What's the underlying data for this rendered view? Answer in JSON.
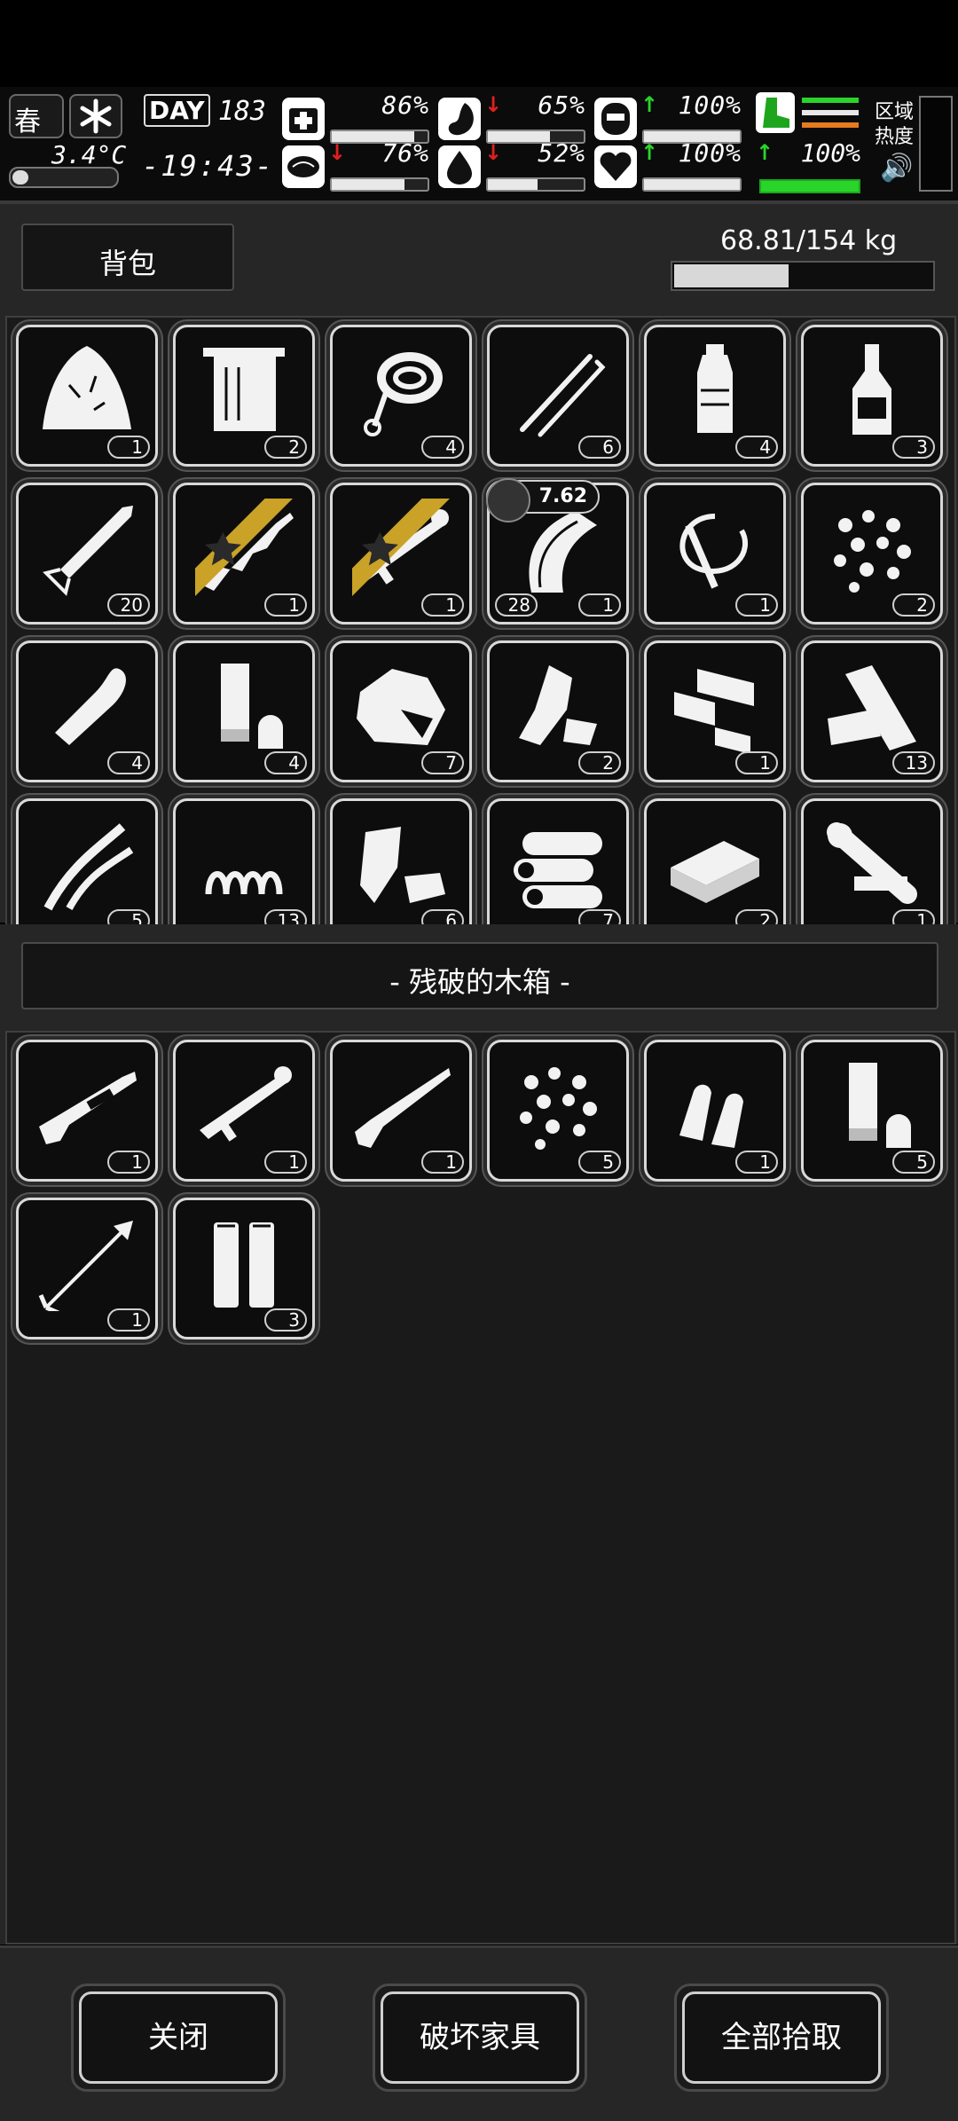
{
  "hud": {
    "season": "春",
    "temperature": "3.4°C",
    "day_label": "DAY",
    "day_number": "183",
    "clock": "-19:43-",
    "stats": {
      "health": "86%",
      "hunger": "65%",
      "armor": "100%",
      "mood": "76%",
      "thirst": "52%",
      "heart": "100%",
      "stamina": "100%"
    },
    "stat_levels": {
      "health": 86,
      "hunger": 65,
      "armor": 100,
      "mood": 76,
      "thirst": 52,
      "heart": 100,
      "stamina": 100
    },
    "area_heat_label_1": "区域",
    "area_heat_label_2": "热度"
  },
  "backpack": {
    "title": "背包",
    "weight": "68.81/154 kg",
    "weight_fraction": 0.4468
  },
  "backpack_items": [
    {
      "icon": "cloth-rag-icon",
      "count": "1"
    },
    {
      "icon": "towel-icon",
      "count": "2"
    },
    {
      "icon": "rope-icon",
      "count": "4"
    },
    {
      "icon": "lockpick-icon",
      "count": "6"
    },
    {
      "icon": "water-bottle-icon",
      "count": "4"
    },
    {
      "icon": "liquor-bottle-icon",
      "count": "3"
    },
    {
      "icon": "rocket-icon",
      "count": "20"
    },
    {
      "icon": "assault-rifle-icon",
      "count": "1",
      "starred": true
    },
    {
      "icon": "rocket-launcher-icon",
      "count": "1",
      "starred": true
    },
    {
      "icon": "magazine-icon",
      "count": "1",
      "ammo_caliber": "7.62",
      "ammo_count": "28"
    },
    {
      "icon": "whip-icon",
      "count": "1"
    },
    {
      "icon": "pellets-icon",
      "count": "2"
    },
    {
      "icon": "bullet-icon",
      "count": "4"
    },
    {
      "icon": "shotgun-shell-icon",
      "count": "4"
    },
    {
      "icon": "ore-rock-icon",
      "count": "7"
    },
    {
      "icon": "plastic-scrap-icon",
      "count": "2"
    },
    {
      "icon": "bricks-icon",
      "count": "1"
    },
    {
      "icon": "wood-planks-icon",
      "count": "13"
    },
    {
      "icon": "wires-icon",
      "count": "5"
    },
    {
      "icon": "spring-icon",
      "count": "13"
    },
    {
      "icon": "metal-scrap-icon",
      "count": "6"
    },
    {
      "icon": "logs-icon",
      "count": "7"
    },
    {
      "icon": "whetstone-icon",
      "count": "2"
    },
    {
      "icon": "scope-icon",
      "count": "1"
    }
  ],
  "container": {
    "title": "- 残破的木箱 -"
  },
  "container_items": [
    {
      "icon": "shotgun-icon",
      "count": "1"
    },
    {
      "icon": "rocket-launcher-icon",
      "count": "1"
    },
    {
      "icon": "hunting-rifle-icon",
      "count": "1"
    },
    {
      "icon": "pellets-icon",
      "count": "5"
    },
    {
      "icon": "bullets-icon",
      "count": "1"
    },
    {
      "icon": "shotgun-shell-icon",
      "count": "5"
    },
    {
      "icon": "arrow-icon",
      "count": "1"
    },
    {
      "icon": "large-cartridge-icon",
      "count": "3"
    }
  ],
  "footer": {
    "close": "关闭",
    "destroy_furniture": "破坏家具",
    "take_all": "全部拾取"
  }
}
